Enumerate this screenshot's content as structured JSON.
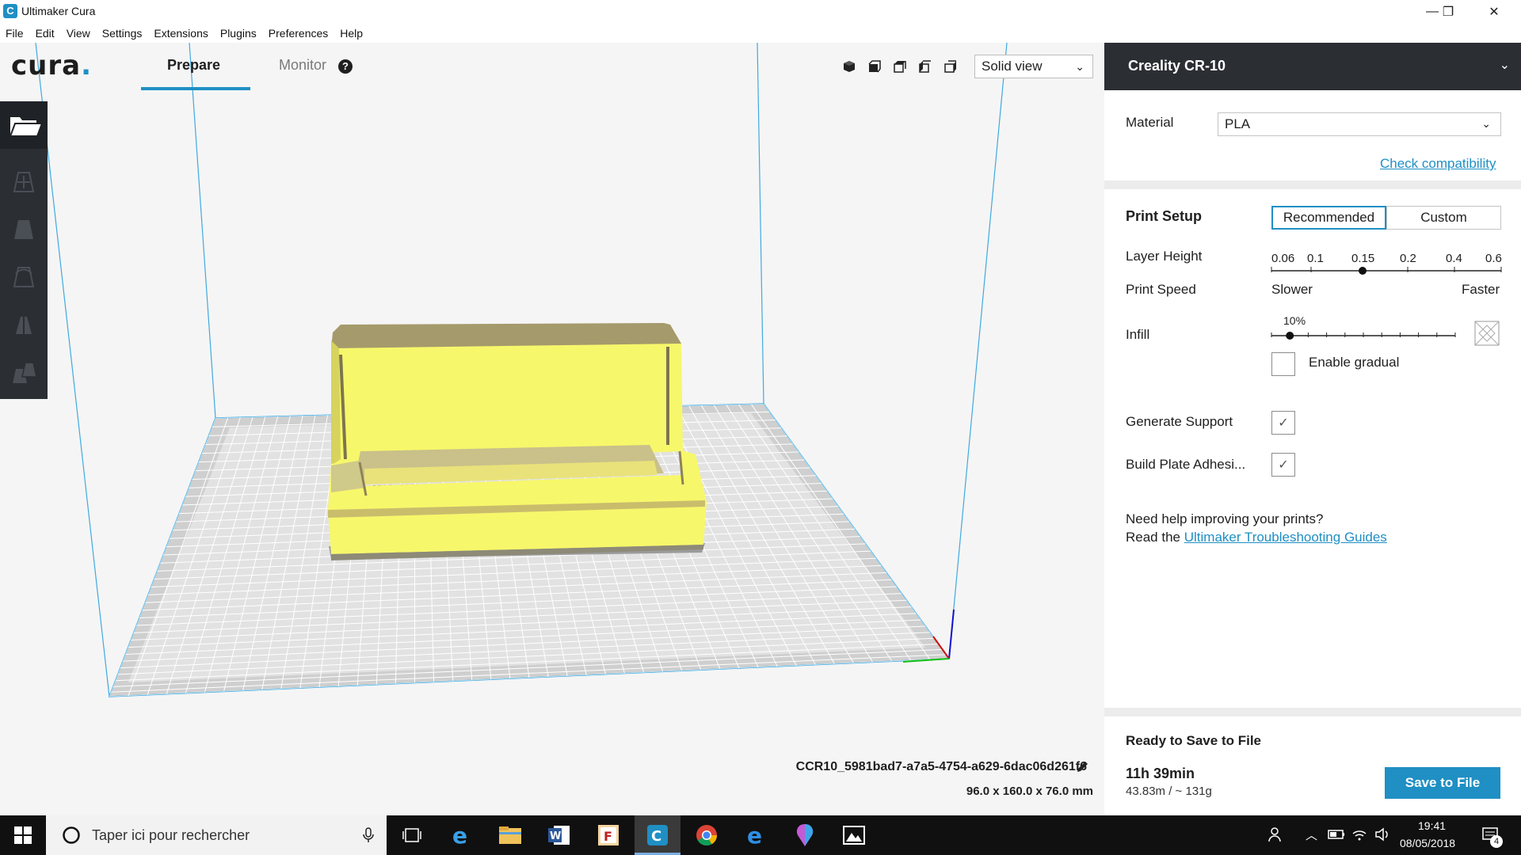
{
  "window": {
    "title": "Ultimaker Cura",
    "minimize": "—",
    "restore": "❐",
    "close": "✕"
  },
  "menu": [
    "File",
    "Edit",
    "View",
    "Settings",
    "Extensions",
    "Plugins",
    "Preferences",
    "Help"
  ],
  "header": {
    "logo_text": "cura",
    "logo_dot": ".",
    "tabs": [
      {
        "label": "Prepare",
        "active": true
      },
      {
        "label": "Monitor",
        "active": false
      }
    ],
    "help_icon": "?",
    "view_mode": "Solid view"
  },
  "viewport": {
    "file_name": "CCR10_5981bad7-a7a5-4754-a629-6dac06d261f6",
    "dimensions": "96.0 x 160.0 x 76.0 mm",
    "model_color": "#f7f76b",
    "model_shade": "#b2a56a"
  },
  "toolbar": {
    "tools": [
      "open-file-icon",
      "move-icon",
      "scale-icon",
      "rotate-icon",
      "mirror-icon",
      "per-model-settings-icon"
    ]
  },
  "sidebar": {
    "printer_name": "Creality CR-10",
    "material_label": "Material",
    "material_value": "PLA",
    "check_compat": "Check compatibility",
    "print_setup": "Print Setup",
    "mode_buttons": [
      {
        "label": "Recommended",
        "selected": true
      },
      {
        "label": "Custom",
        "selected": false
      }
    ],
    "layer_height_label": "Layer Height",
    "layer_height_ticks": [
      "0.06",
      "0.1",
      "0.15",
      "0.2",
      "0.4",
      "0.6"
    ],
    "layer_height_selected": "0.15",
    "print_speed_label": "Print Speed",
    "speed_slower": "Slower",
    "speed_faster": "Faster",
    "infill_label": "Infill",
    "infill_value": "10%",
    "infill_fraction": 0.1,
    "enable_gradual": "Enable gradual",
    "enable_gradual_checked": false,
    "generate_support": "Generate Support",
    "generate_support_checked": true,
    "adhesion": "Build Plate Adhesi...",
    "adhesion_checked": true,
    "help_line1": "Need help improving your prints?",
    "help_line2_prefix": "Read the ",
    "help_link": "Ultimaker Troubleshooting Guides",
    "ready": "Ready to Save to File",
    "time": "11h 39min",
    "usage": "43.83m / ~ 131g",
    "save_button": "Save to File",
    "accent": "#1f8fc4"
  },
  "taskbar": {
    "search_placeholder": "Taper ici pour rechercher",
    "apps": [
      "task-view-icon",
      "internet-explorer-icon",
      "file-explorer-icon",
      "word-icon",
      "filezilla-icon",
      "cura-icon",
      "chrome-icon",
      "edge-icon",
      "paint3d-icon",
      "photos-icon"
    ],
    "time": "19:41",
    "date": "08/05/2018",
    "notification_count": "4"
  }
}
